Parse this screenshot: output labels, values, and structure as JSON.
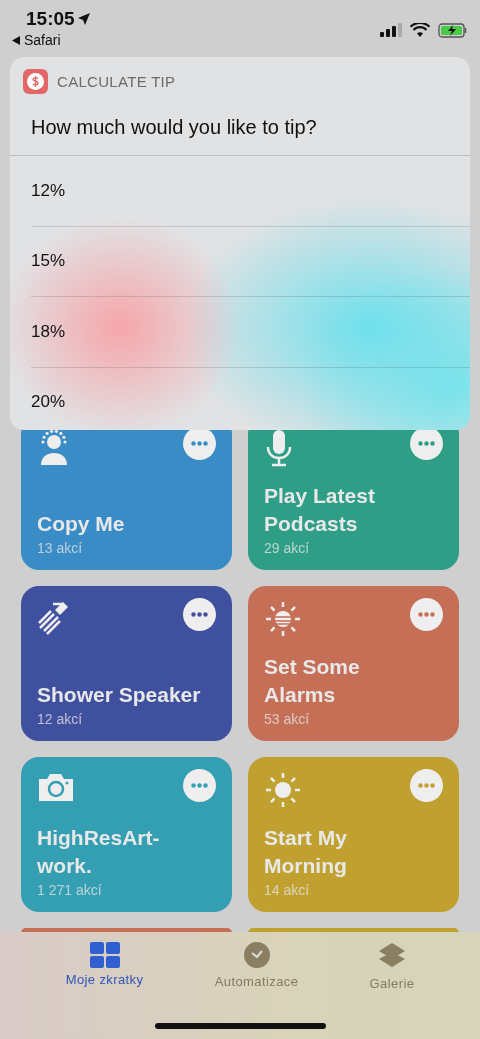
{
  "status_bar": {
    "time": "15:05",
    "back_label": "Safari"
  },
  "prompt": {
    "app_name": "CALCULATE TIP",
    "question": "How much would you like to tip?",
    "options": [
      {
        "label": "12%"
      },
      {
        "label": "15%"
      },
      {
        "label": "18%"
      },
      {
        "label": "20%"
      }
    ]
  },
  "shortcut_rows": [
    {
      "shortcuts": [
        {
          "kind": "full",
          "title": "Copy Me",
          "count": "13 akcí",
          "color": "#3a8cc6"
        },
        {
          "kind": "full",
          "title": "Play Latest Podcasts",
          "count": "29 akcí",
          "color": "#2e9f86"
        }
      ]
    },
    {
      "shortcuts": [
        {
          "kind": "full",
          "title": "Shower Speaker",
          "count": "12 akcí",
          "color": "#3f509e"
        },
        {
          "kind": "full",
          "title": "Set Some Alarms",
          "count": "53 akcí",
          "color": "#c56f57"
        }
      ]
    },
    {
      "shortcuts": [
        {
          "kind": "full",
          "title": "HighResArt-work.",
          "count": "1 271 akcí",
          "color": "#349fb2"
        },
        {
          "kind": "full",
          "title": "Start My Morning",
          "count": "14 akcí",
          "color": "#c0a12f"
        }
      ]
    },
    {
      "shortcuts": [
        {
          "kind": "cut",
          "color": "#c56f57"
        },
        {
          "kind": "cut",
          "color": "#c0a12f"
        }
      ]
    }
  ],
  "tab_bar": [
    {
      "label": "Moje zkratky",
      "selected": true
    },
    {
      "label": "Automatizace",
      "selected": false
    },
    {
      "label": "Galerie",
      "selected": false
    }
  ]
}
